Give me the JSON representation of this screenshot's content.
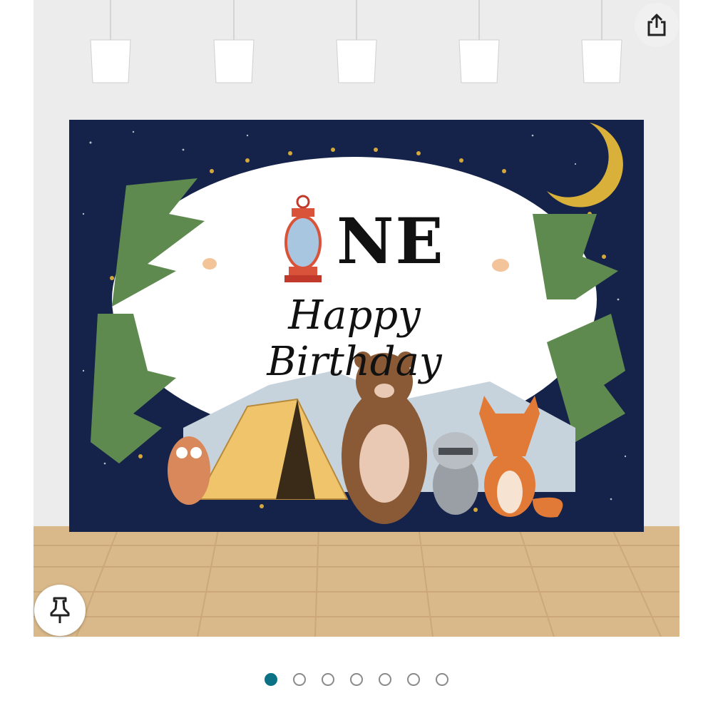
{
  "product": {
    "banner": {
      "number_word_suffix": "NE",
      "greeting": "Happy Birthday"
    }
  },
  "actions": {
    "share_icon": "share-icon",
    "pin_icon": "pushpin-icon"
  },
  "carousel": {
    "total": 7,
    "active_index": 0
  },
  "colors": {
    "accent": "#0b7285",
    "night_sky": "#15224a",
    "floor": "#d9b88a"
  }
}
